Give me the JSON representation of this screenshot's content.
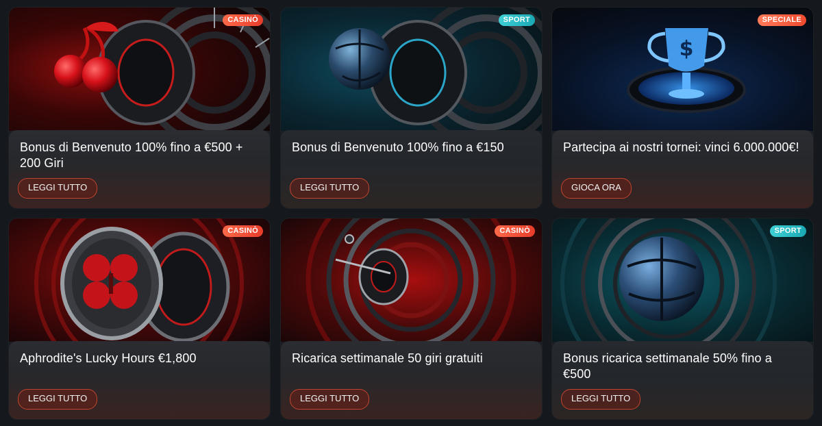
{
  "promotions": [
    {
      "badge": "CASINÒ",
      "badge_type": "casino",
      "title": "Bonus di Benvenuto 100% fino a €500 + 200 Giri",
      "cta": "LEGGI TUTTO",
      "art": "cherries-on-roulette"
    },
    {
      "badge": "SPORT",
      "badge_type": "sport",
      "title": "Bonus di Benvenuto 100% fino a €150",
      "cta": "LEGGI TUTTO",
      "art": "ball-on-roulette"
    },
    {
      "badge": "SPECIALE",
      "badge_type": "speciale",
      "title": "Partecipa ai nostri tornei: vinci 6.000.000€!",
      "cta": "GIOCA ORA",
      "art": "trophy-cup"
    },
    {
      "badge": "CASINÒ",
      "badge_type": "casino",
      "title": "Aphrodite's Lucky Hours €1,800",
      "cta": "LEGGI TUTTO",
      "art": "clover-coin"
    },
    {
      "badge": "CASINÒ",
      "badge_type": "casino",
      "title": "Ricarica settimanale 50 giri gratuiti",
      "cta": "LEGGI TUTTO",
      "art": "spinning-tunnel"
    },
    {
      "badge": "SPORT",
      "badge_type": "sport",
      "title": "Bonus ricarica settimanale 50% fino a €500",
      "cta": "LEGGI TUTTO",
      "art": "ball-tunnel"
    }
  ],
  "colors": {
    "page_bg": "#15181c",
    "cta_border": "#c0442f",
    "casino_badge": "#e63c2a",
    "sport_badge": "#1aa8b3",
    "speciale_badge": "#ef4a2e"
  }
}
